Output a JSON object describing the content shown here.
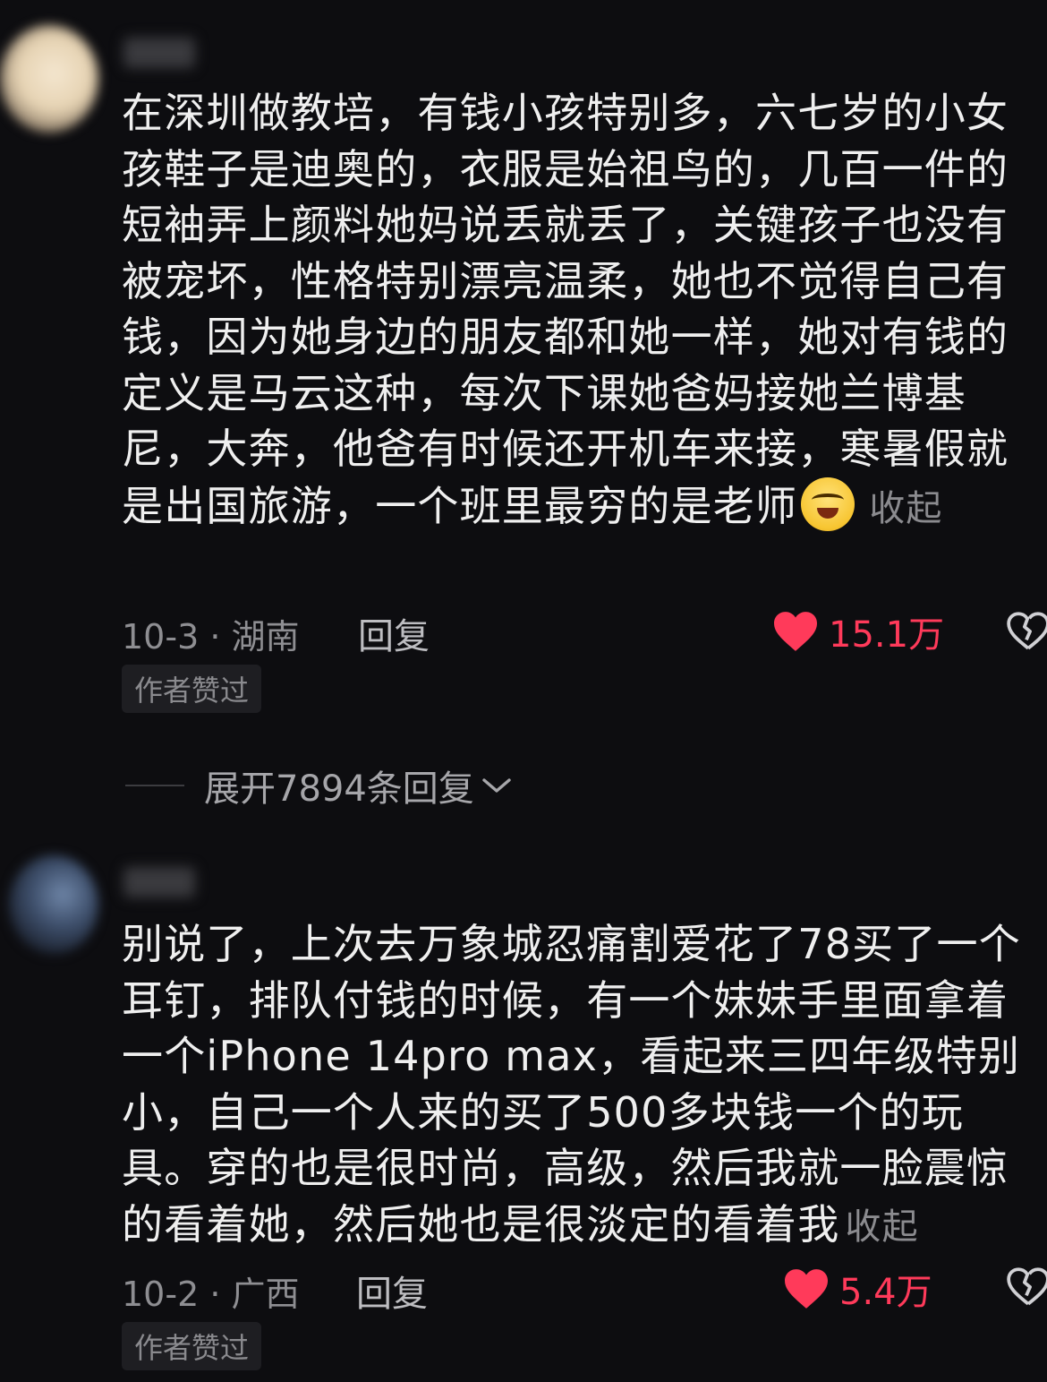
{
  "comments": [
    {
      "text": "在深圳做教培，有钱小孩特别多，六七岁的小女孩鞋子是迪奥的，衣服是始祖鸟的，几百一件的短袖弄上颜料她妈说丢就丢了，关键孩子也没有被宠坏，性格特别漂亮温柔，她也不觉得自己有钱，因为她身边的朋友都和她一样，她对有钱的定义是马云这种，每次下课她爸妈接她兰博基尼，大奔，他爸有时候还开机车来接，寒暑假就是出国旅游，一个班里最穷的是老师",
      "emoji": "crying-laughing-emoji",
      "collapse_label": "收起",
      "date_location": "10-3 · 湖南",
      "reply_label": "回复",
      "likes": "15.1万",
      "badge": "作者赞过"
    },
    {
      "text": "别说了，上次去万象城忍痛割爱花了78买了一个耳钉，排队付钱的时候，有一个妹妹手里面拿着一个iPhone 14pro max，看起来三四年级特别小，自己一个人来的买了500多块钱一个的玩具。穿的也是很时尚，高级，然后我就一脸震惊的看着她，然后她也是很淡定的看着我",
      "collapse_label": "收起",
      "date_location": "10-2 · 广西",
      "reply_label": "回复",
      "likes": "5.4万",
      "badge": "作者赞过"
    }
  ],
  "expand_replies": "展开7894条回复",
  "colors": {
    "background": "#0d0d10",
    "like": "#ff3a5a",
    "muted": "#8e8e92"
  },
  "icons": {
    "like": "heart-icon",
    "dislike": "broken-heart-icon",
    "expand": "chevron-down-icon"
  }
}
